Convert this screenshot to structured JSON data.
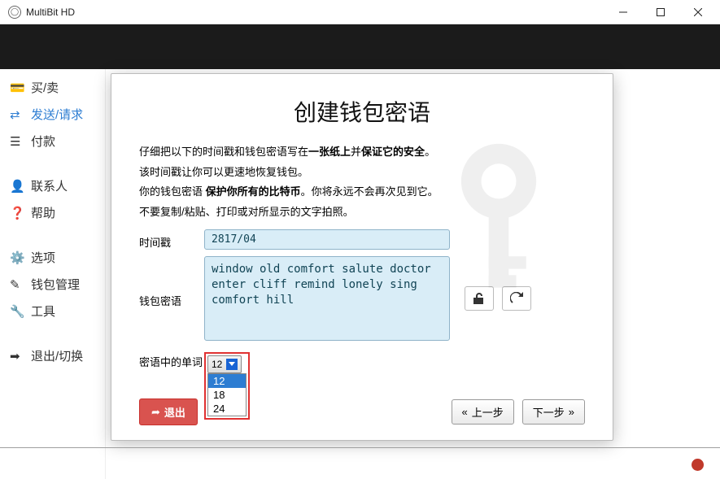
{
  "window": {
    "title": "MultiBit HD"
  },
  "sidebar": {
    "group1": [
      {
        "icon": "wallet",
        "label": "买/卖"
      },
      {
        "icon": "transfer",
        "label": "发送/请求",
        "active": true
      },
      {
        "icon": "list",
        "label": "付款"
      }
    ],
    "group2": [
      {
        "icon": "user",
        "label": "联系人"
      },
      {
        "icon": "help",
        "label": "帮助"
      }
    ],
    "group3": [
      {
        "icon": "gears",
        "label": "选项"
      },
      {
        "icon": "edit",
        "label": "钱包管理"
      },
      {
        "icon": "wrench",
        "label": "工具"
      }
    ],
    "group4": [
      {
        "icon": "logout",
        "label": "退出/切换"
      }
    ]
  },
  "modal": {
    "title": "创建钱包密语",
    "line1a": "仔细把以下的时间戳和钱包密语写在",
    "line1b": "一张纸上",
    "line1c": "并",
    "line1d": "保证它的安全",
    "line1e": "。",
    "line2": "该时间戳让你可以更速地恢复钱包。",
    "line3a": "你的钱包密语 ",
    "line3b": "保护你所有的比特币",
    "line3c": "。你将永远不会再次见到它。",
    "line4": "不要复制/粘贴、打印或对所显示的文字拍照。",
    "timestamp_label": "时间戳",
    "timestamp_value": "2817/04",
    "seed_label": "钱包密语",
    "seed_value": "window old comfort salute doctor enter cliff remind lonely sing comfort hill",
    "wordcount_label": "密语中的单词",
    "select_value": "12",
    "select_options": [
      "12",
      "18",
      "24"
    ],
    "exit_label": "退出",
    "prev_label": "上一步",
    "next_label": "下一步"
  }
}
